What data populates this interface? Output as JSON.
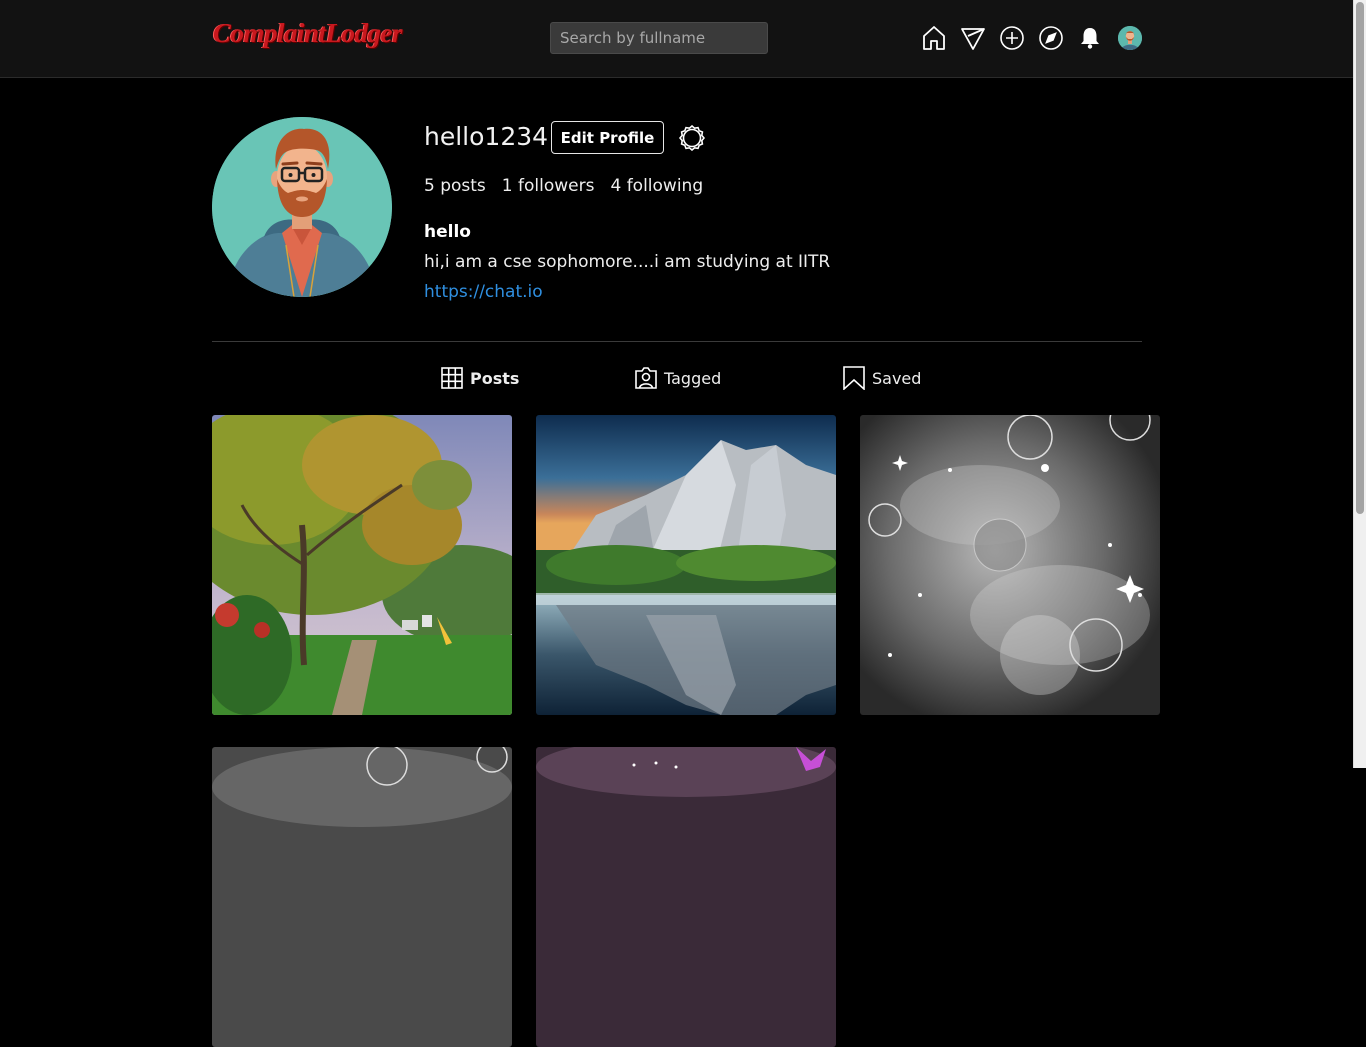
{
  "header": {
    "logo_text": "ComplaintLodger",
    "search_placeholder": "Search by fullname",
    "icons": [
      "home-icon",
      "send-icon",
      "add-post-icon",
      "explore-icon",
      "notification-bell-icon",
      "profile-avatar"
    ]
  },
  "profile": {
    "username": "hello1234",
    "edit_label": "Edit Profile",
    "stats": {
      "posts": "5 posts",
      "followers": "1 followers",
      "following": "4 following"
    },
    "bio_name": "hello",
    "bio_text": "hi,i am a cse sophomore....i am studying at IITR",
    "link": "https://chat.io"
  },
  "tabs": [
    {
      "label": "Posts",
      "icon": "grid-icon",
      "active": true
    },
    {
      "label": "Tagged",
      "icon": "tagged-person-icon",
      "active": false
    },
    {
      "label": "Saved",
      "icon": "bookmark-icon",
      "active": false
    }
  ],
  "posts": [
    {
      "subject": "park-trees"
    },
    {
      "subject": "cliff-lake-reflection"
    },
    {
      "subject": "space-bubbles"
    },
    {
      "subject": "space-bubbles-2"
    },
    {
      "subject": "purple-flower"
    }
  ],
  "colors": {
    "background": "#000000",
    "header": "#121212",
    "link": "#2f8fe0",
    "logo": "#c8181e"
  }
}
